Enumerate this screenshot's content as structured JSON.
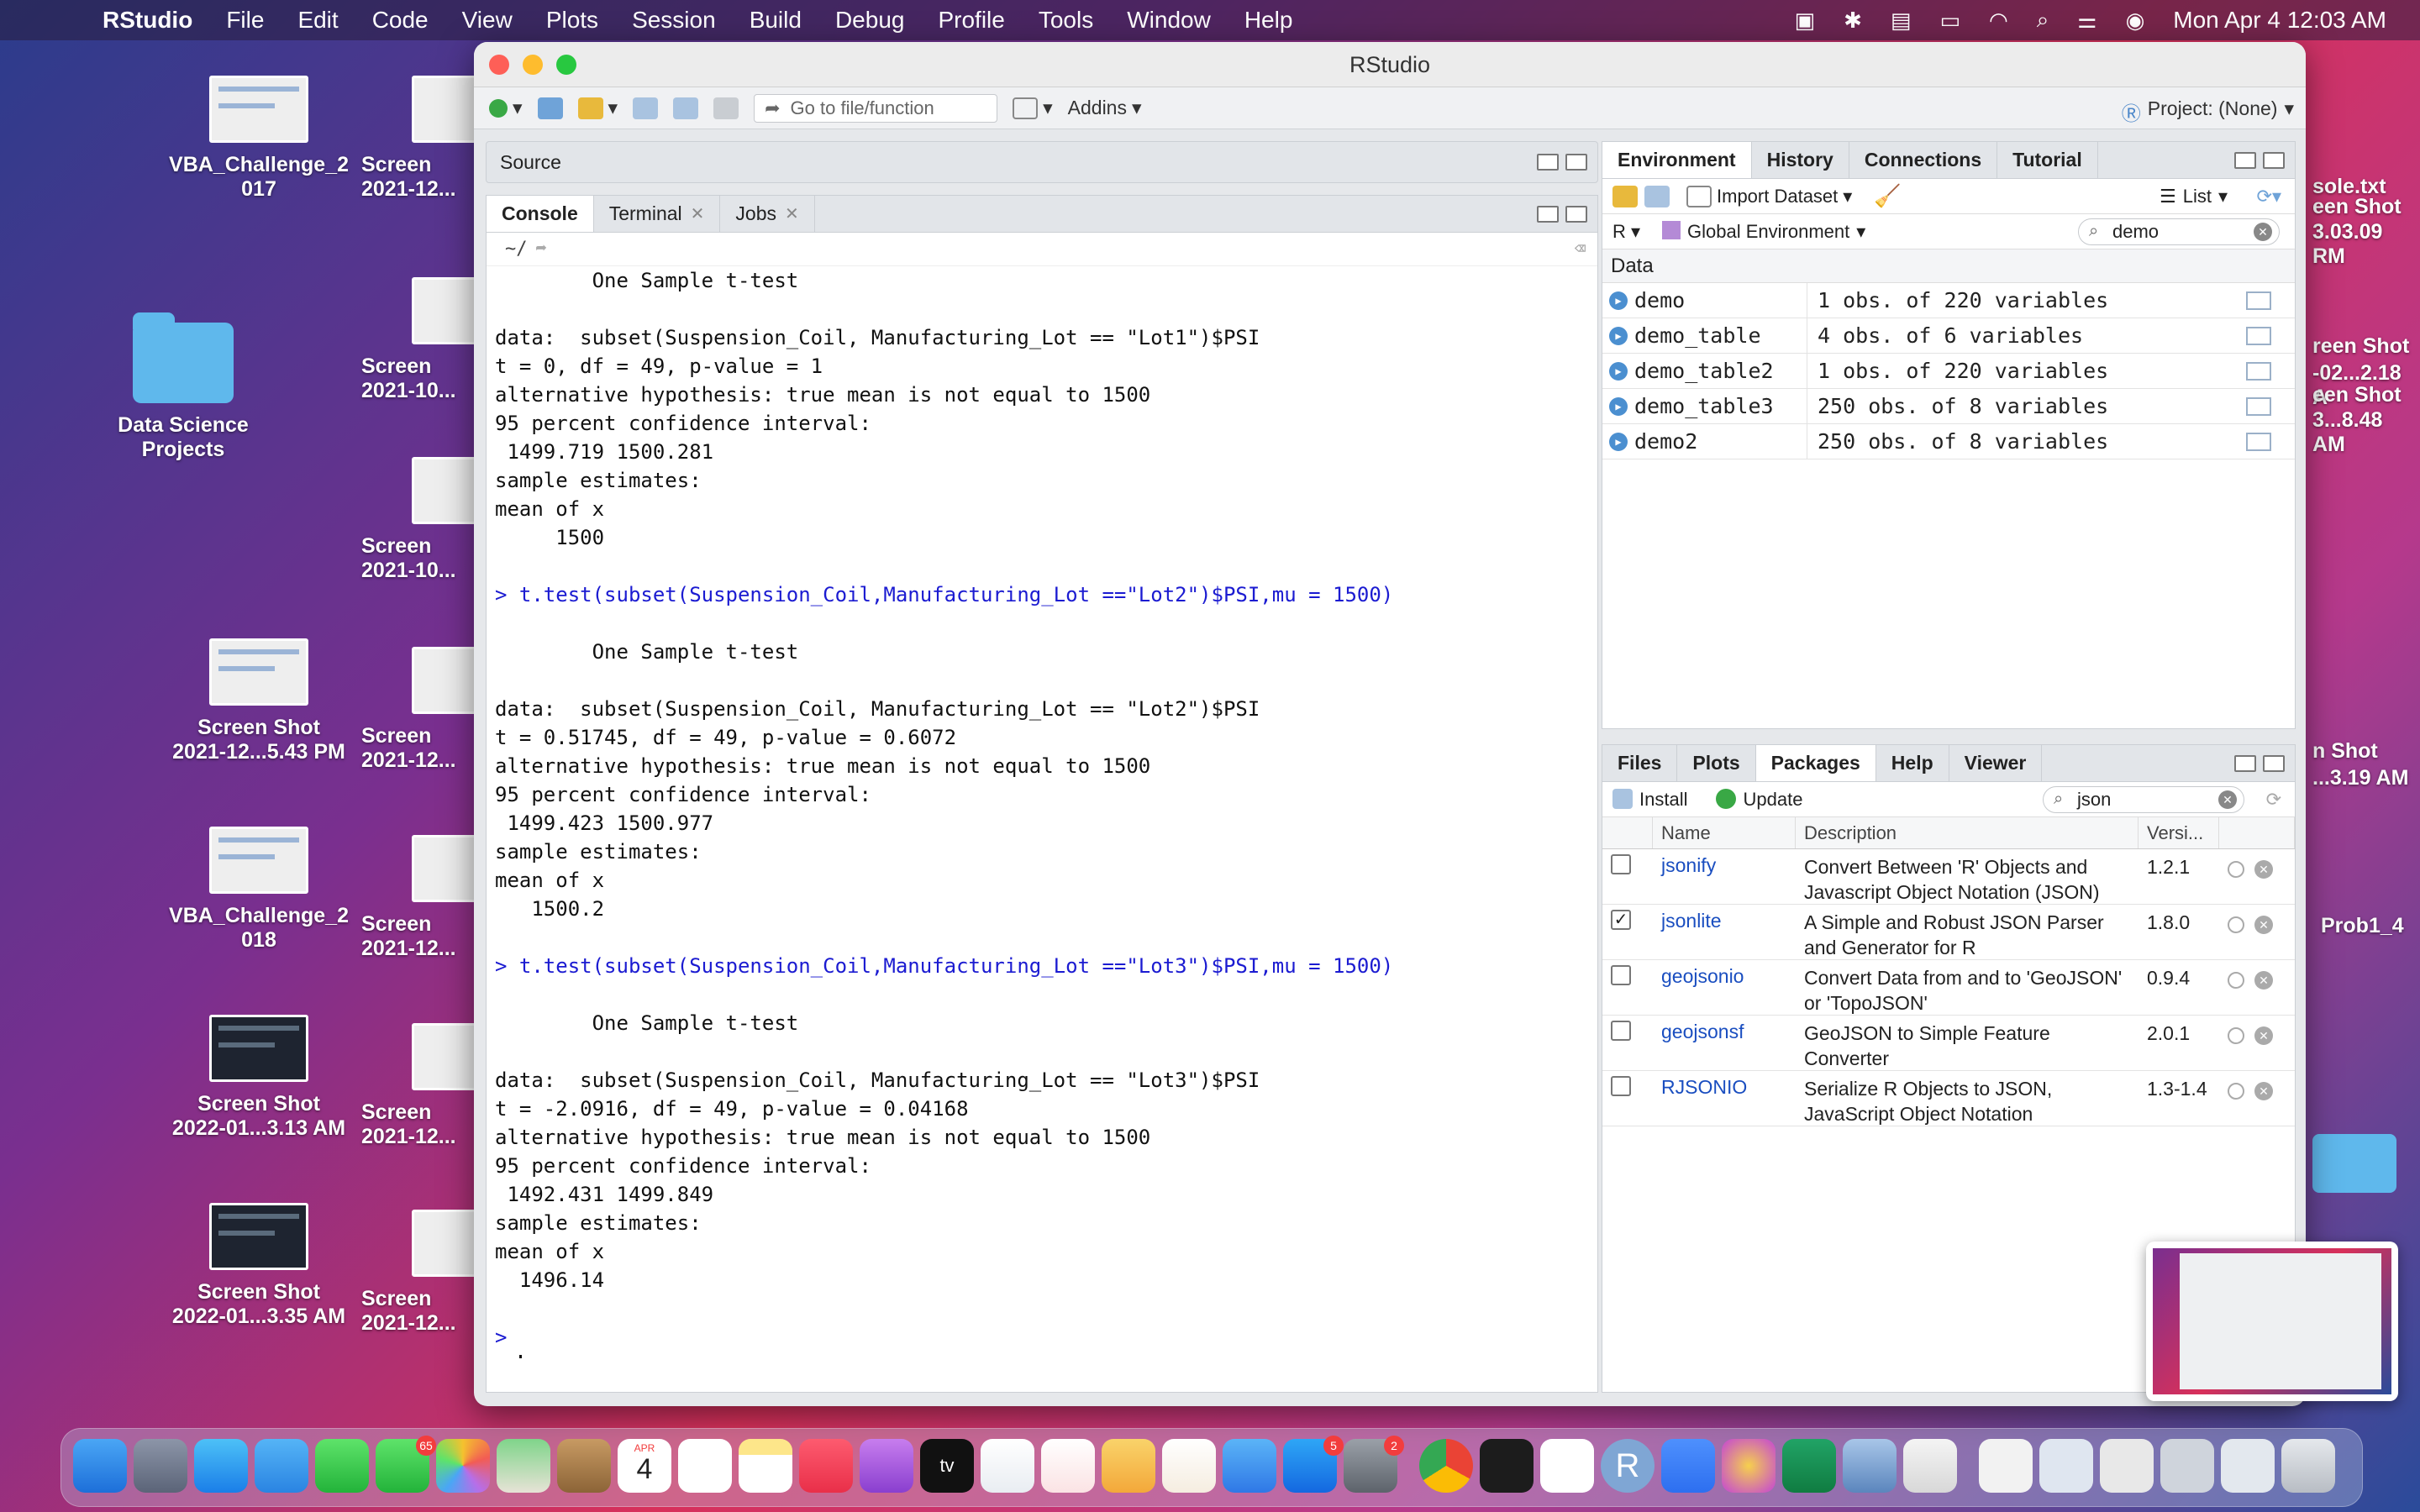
{
  "menubar": {
    "app_name": "RStudio",
    "items": [
      "File",
      "Edit",
      "Code",
      "View",
      "Plots",
      "Session",
      "Build",
      "Debug",
      "Profile",
      "Tools",
      "Window",
      "Help"
    ],
    "clock": "Mon Apr 4  12:03 AM"
  },
  "desktop": {
    "left_col": [
      {
        "label": "VBA_Challenge_2\n017"
      },
      {
        "label": "Data Science\nProjects"
      },
      {
        "label": "Screen Shot\n2021-12...5.43 PM"
      },
      {
        "label": "VBA_Challenge_2\n018"
      },
      {
        "label": "Screen Shot\n2022-01...3.13 AM"
      },
      {
        "label": "Screen Shot\n2022-01...3.35 AM"
      }
    ],
    "second_col": [
      {
        "label": "Screen\n2021-12..."
      },
      {
        "label": "Screen\n2021-10..."
      },
      {
        "label": "Screen\n2021-10..."
      },
      {
        "label": "Screen\n2021-12..."
      },
      {
        "label": "Screen\n2021-12..."
      },
      {
        "label": "Screen\n2021-12..."
      },
      {
        "label": "Screen\n2021-12..."
      }
    ],
    "right_side": {
      "label_a": "sole.txt",
      "label_b": "een Shot",
      "label_c": "3.03.09 RM",
      "label_d": "reen Shot",
      "label_e": "-02...2.18 A",
      "label_f": "een Shot",
      "label_g": "3...8.48 AM",
      "label_h": "n Shot",
      "label_i": "...3.19 AM",
      "label_j": "Prob1_4"
    }
  },
  "window": {
    "title": "RStudio",
    "toolbar": {
      "goto_placeholder": "Go to file/function",
      "addins": "Addins",
      "project": "Project: (None)"
    },
    "source_label": "Source",
    "console_tabs": [
      {
        "label": "Console",
        "active": true,
        "closable": false
      },
      {
        "label": "Terminal",
        "active": false,
        "closable": true
      },
      {
        "label": "Jobs",
        "active": false,
        "closable": true
      }
    ],
    "console_path": "~/",
    "console_lines": [
      {
        "t": "        One Sample t-test",
        "cmd": false
      },
      {
        "t": "",
        "cmd": false
      },
      {
        "t": "data:  subset(Suspension_Coil, Manufacturing_Lot == \"Lot1\")$PSI",
        "cmd": false
      },
      {
        "t": "t = 0, df = 49, p-value = 1",
        "cmd": false
      },
      {
        "t": "alternative hypothesis: true mean is not equal to 1500",
        "cmd": false
      },
      {
        "t": "95 percent confidence interval:",
        "cmd": false
      },
      {
        "t": " 1499.719 1500.281",
        "cmd": false
      },
      {
        "t": "sample estimates:",
        "cmd": false
      },
      {
        "t": "mean of x",
        "cmd": false
      },
      {
        "t": "     1500",
        "cmd": false
      },
      {
        "t": "",
        "cmd": false
      },
      {
        "t": "> t.test(subset(Suspension_Coil,Manufacturing_Lot ==\"Lot2\")$PSI,mu = 1500)",
        "cmd": true
      },
      {
        "t": "",
        "cmd": false
      },
      {
        "t": "        One Sample t-test",
        "cmd": false
      },
      {
        "t": "",
        "cmd": false
      },
      {
        "t": "data:  subset(Suspension_Coil, Manufacturing_Lot == \"Lot2\")$PSI",
        "cmd": false
      },
      {
        "t": "t = 0.51745, df = 49, p-value = 0.6072",
        "cmd": false
      },
      {
        "t": "alternative hypothesis: true mean is not equal to 1500",
        "cmd": false
      },
      {
        "t": "95 percent confidence interval:",
        "cmd": false
      },
      {
        "t": " 1499.423 1500.977",
        "cmd": false
      },
      {
        "t": "sample estimates:",
        "cmd": false
      },
      {
        "t": "mean of x",
        "cmd": false
      },
      {
        "t": "   1500.2",
        "cmd": false
      },
      {
        "t": "",
        "cmd": false
      },
      {
        "t": "> t.test(subset(Suspension_Coil,Manufacturing_Lot ==\"Lot3\")$PSI,mu = 1500)",
        "cmd": true
      },
      {
        "t": "",
        "cmd": false
      },
      {
        "t": "        One Sample t-test",
        "cmd": false
      },
      {
        "t": "",
        "cmd": false
      },
      {
        "t": "data:  subset(Suspension_Coil, Manufacturing_Lot == \"Lot3\")$PSI",
        "cmd": false
      },
      {
        "t": "t = -2.0916, df = 49, p-value = 0.04168",
        "cmd": false
      },
      {
        "t": "alternative hypothesis: true mean is not equal to 1500",
        "cmd": false
      },
      {
        "t": "95 percent confidence interval:",
        "cmd": false
      },
      {
        "t": " 1492.431 1499.849",
        "cmd": false
      },
      {
        "t": "sample estimates:",
        "cmd": false
      },
      {
        "t": "mean of x",
        "cmd": false
      },
      {
        "t": "  1496.14",
        "cmd": false
      },
      {
        "t": "",
        "cmd": false
      },
      {
        "t": ">",
        "cmd": true
      }
    ],
    "prompt": ">",
    "env": {
      "tabs": [
        "Environment",
        "History",
        "Connections",
        "Tutorial"
      ],
      "import_dataset": "Import Dataset",
      "list_label": "List",
      "r_label": "R",
      "global_env": "Global Environment",
      "search_value": "demo",
      "section": "Data",
      "rows": [
        {
          "name": "demo",
          "value": "1 obs. of 220 variables"
        },
        {
          "name": "demo_table",
          "value": "4 obs. of 6 variables"
        },
        {
          "name": "demo_table2",
          "value": "1 obs. of 220 variables"
        },
        {
          "name": "demo_table3",
          "value": "250 obs. of 8 variables"
        },
        {
          "name": "demo2",
          "value": "250 obs. of 8 variables"
        }
      ]
    },
    "files": {
      "tabs": [
        "Files",
        "Plots",
        "Packages",
        "Help",
        "Viewer"
      ],
      "active_tab": "Packages",
      "install": "Install",
      "update": "Update",
      "search_value": "json",
      "columns": [
        "Name",
        "Description",
        "Versi..."
      ],
      "packages": [
        {
          "name": "jsonify",
          "desc": "Convert Between 'R' Objects and Javascript Object Notation (JSON)",
          "version": "1.2.1",
          "checked": false
        },
        {
          "name": "jsonlite",
          "desc": "A Simple and Robust JSON Parser and Generator for R",
          "version": "1.8.0",
          "checked": true
        },
        {
          "name": "geojsonio",
          "desc": "Convert Data from and to 'GeoJSON' or 'TopoJSON'",
          "version": "0.9.4",
          "checked": false
        },
        {
          "name": "geojsonsf",
          "desc": "GeoJSON to Simple Feature Converter",
          "version": "2.0.1",
          "checked": false
        },
        {
          "name": "RJSONIO",
          "desc": "Serialize R Objects to JSON, JavaScript Object Notation",
          "version": "1.3-1.4",
          "checked": false
        }
      ]
    }
  },
  "dock": {
    "badges": {
      "messages": "65",
      "appstore": "5",
      "sysprefs": "2"
    },
    "calendar_month": "APR",
    "calendar_day": "4"
  }
}
